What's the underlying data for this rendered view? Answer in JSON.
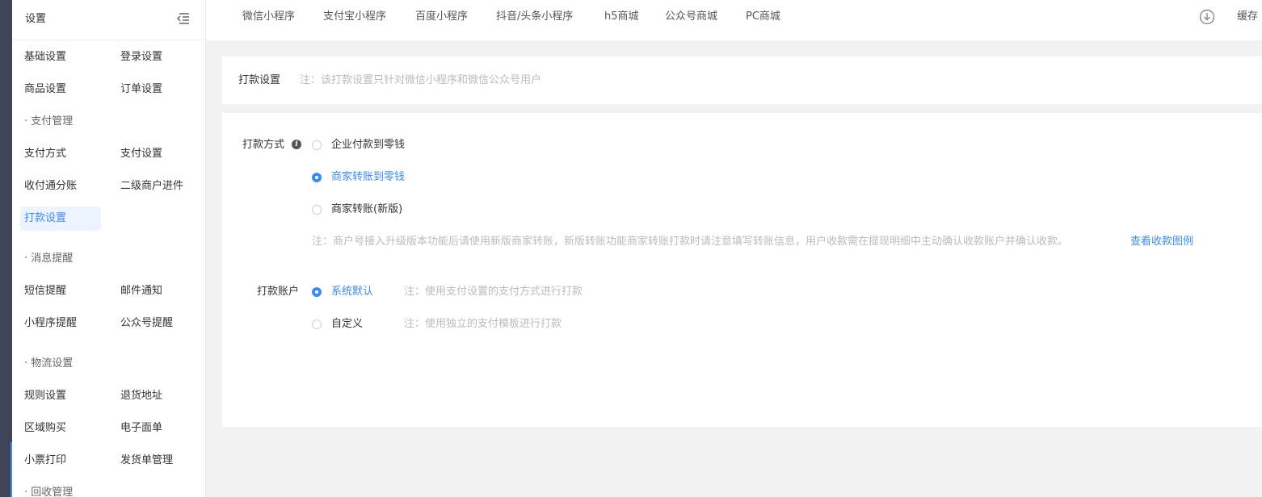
{
  "sidebar": {
    "title": "设置",
    "menu_icon": "list-collapse-icon",
    "rows": [
      {
        "type": "pair",
        "left": "基础设置",
        "right": "登录设置"
      },
      {
        "type": "pair",
        "left": "商品设置",
        "right": "订单设置"
      },
      {
        "type": "section",
        "label": "· 支付管理"
      },
      {
        "type": "pair",
        "left": "支付方式",
        "right": "支付设置"
      },
      {
        "type": "pair",
        "left": "收付通分账",
        "right": "二级商户进件"
      },
      {
        "type": "active",
        "left": "打款设置"
      },
      {
        "type": "section",
        "label": "· 消息提醒",
        "gap": true
      },
      {
        "type": "pair",
        "left": "短信提醒",
        "right": "邮件通知"
      },
      {
        "type": "pair",
        "left": "小程序提醒",
        "right": "公众号提醒"
      },
      {
        "type": "section",
        "label": "· 物流设置",
        "gap": true
      },
      {
        "type": "pair",
        "left": "规则设置",
        "right": "退货地址"
      },
      {
        "type": "pair",
        "left": "区域购买",
        "right": "电子面单"
      },
      {
        "type": "pair",
        "left": "小票打印",
        "right": "发货单管理"
      },
      {
        "type": "section",
        "label": "· 回收管理"
      }
    ]
  },
  "topbar": {
    "tabs": [
      "微信小程序",
      "支付宝小程序",
      "百度小程序",
      "抖音/头条小程序",
      "h5商城",
      "公众号商城",
      "PC商城"
    ],
    "download_icon": "download-circle-icon",
    "cache_label": "缓存"
  },
  "header_card": {
    "title": "打款设置",
    "note": "注：该打款设置只针对微信小程序和微信公众号用户"
  },
  "form": {
    "payout_method": {
      "label": "打款方式",
      "info_icon": "info-icon",
      "options": [
        {
          "label": "企业付款到零钱",
          "checked": false
        },
        {
          "label": "商家转账到零钱",
          "checked": true
        },
        {
          "label": "商家转账(新版)",
          "checked": false
        }
      ],
      "note": "注：商户号接入升级版本功能后请使用新版商家转账，新版转账功能商家转账打款时请注意填写转账信息，用户收款需在提现明细中主动确认收款账户并确认收款。",
      "link": "查看收款图例"
    },
    "payout_account": {
      "label": "打款账户",
      "options": [
        {
          "label": "系统默认",
          "checked": true,
          "note": "注：使用支付设置的支付方式进行打款"
        },
        {
          "label": "自定义",
          "checked": false,
          "note": "注：使用独立的支付模板进行打款"
        }
      ]
    }
  },
  "colors": {
    "accent": "#3d8bf0",
    "page_bg": "#f2f2f2",
    "left_edge": "#3d4556"
  }
}
